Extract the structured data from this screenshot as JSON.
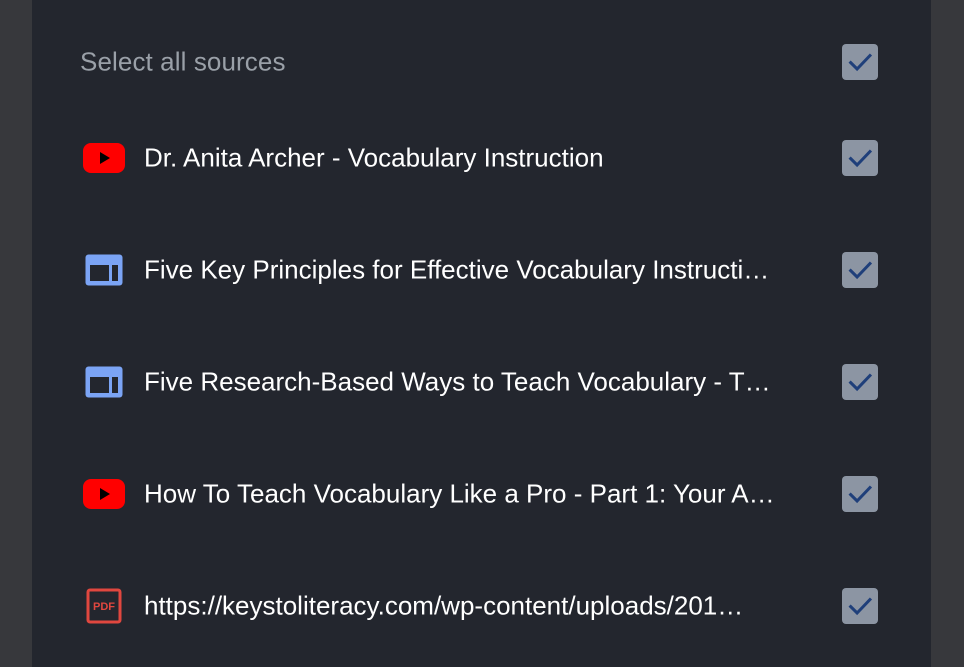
{
  "select_all": {
    "label": "Select all sources",
    "checked": true
  },
  "sources": [
    {
      "icon": "youtube-icon",
      "title": "Dr. Anita Archer - Vocabulary Instruction",
      "checked": true
    },
    {
      "icon": "web-article-icon",
      "title": "Five Key Principles for Effective Vocabulary Instructi…",
      "checked": true
    },
    {
      "icon": "web-article-icon",
      "title": "Five Research-Based Ways to Teach Vocabulary - T…",
      "checked": true
    },
    {
      "icon": "youtube-icon",
      "title": "How To Teach Vocabulary Like a Pro - Part 1: Your A…",
      "checked": true
    },
    {
      "icon": "pdf-icon",
      "title": "https://keystoliteracy.com/wp-content/uploads/201…",
      "checked": true
    }
  ],
  "colors": {
    "panel_bg": "#23262e",
    "outer_bg": "#37383c",
    "checkbox_bg": "#8c95a3",
    "checkmark": "#1f3f7a",
    "youtube_red": "#ff0000",
    "article_blue": "#7ba4f5",
    "pdf_red": "#e0473f"
  }
}
